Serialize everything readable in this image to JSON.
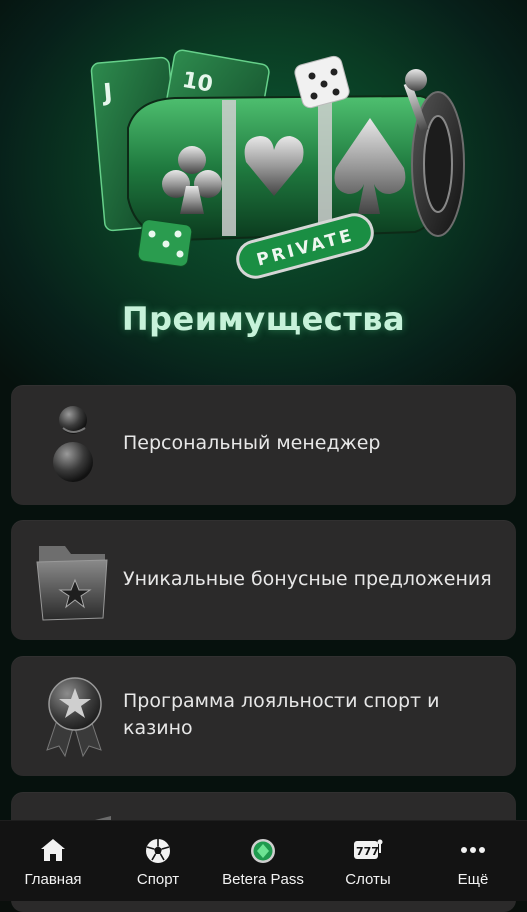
{
  "hero": {
    "badge_text": "PRIVATE",
    "card_j": "J",
    "card_10": "10"
  },
  "headline": "Преимущества",
  "benefits": [
    {
      "icon": "manager-figure-icon",
      "label": "Персональный менеджер"
    },
    {
      "icon": "folder-star-icon",
      "label": "Уникальные бонусные предложения"
    },
    {
      "icon": "medal-star-icon",
      "label": "Программа лояльности спорт и казино"
    },
    {
      "icon": "partial-item-icon",
      "label": ""
    }
  ],
  "nav": [
    {
      "icon": "home-icon",
      "label": "Главная"
    },
    {
      "icon": "soccer-ball-icon",
      "label": "Спорт"
    },
    {
      "icon": "betera-pass-icon",
      "label": "Betera Pass"
    },
    {
      "icon": "slots-777-icon",
      "label": "Слоты"
    },
    {
      "icon": "more-dots-icon",
      "label": "Ещё"
    }
  ],
  "colors": {
    "background": "#07201a",
    "headline": "#c7f2da",
    "card": "#2b2a2a",
    "nav": "#131313",
    "accent_green": "#1f9a4e"
  }
}
